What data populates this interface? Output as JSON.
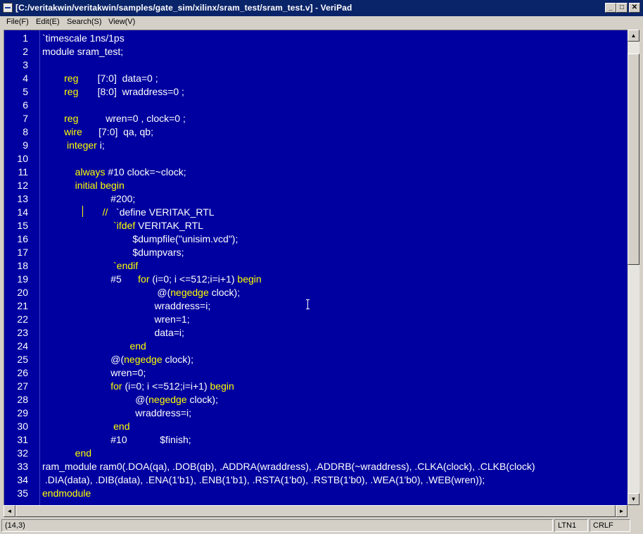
{
  "window": {
    "title": "[C:/veritakwin/veritakwin/samples/gate_sim/xilinx/sram_test/sram_test.v] - VeriPad",
    "minimize_glyph": "_",
    "maximize_glyph": "□",
    "close_glyph": "✕"
  },
  "menu": [
    "File(F)",
    "Edit(E)",
    "Search(S)",
    "View(V)"
  ],
  "editor": {
    "lines": [
      {
        "n": "1",
        "segs": [
          {
            "t": "`timescale 1ns/1ps",
            "c": "plain"
          }
        ]
      },
      {
        "n": "2",
        "segs": [
          {
            "t": "module sram_test;",
            "c": "plain"
          }
        ]
      },
      {
        "n": "3",
        "segs": []
      },
      {
        "n": "4",
        "segs": [
          {
            "t": "        reg       ",
            "c": "kw"
          },
          {
            "t": "[7:0]  data=0 ;",
            "c": "plain"
          }
        ]
      },
      {
        "n": "5",
        "segs": [
          {
            "t": "        reg       ",
            "c": "kw"
          },
          {
            "t": "[8:0]  wraddress=0 ;",
            "c": "plain"
          }
        ]
      },
      {
        "n": "6",
        "segs": []
      },
      {
        "n": "7",
        "segs": [
          {
            "t": "        reg          ",
            "c": "kw"
          },
          {
            "t": "wren=0 , clock=0 ;",
            "c": "plain"
          }
        ]
      },
      {
        "n": "8",
        "segs": [
          {
            "t": "        wire      ",
            "c": "kw"
          },
          {
            "t": "[7:0]  qa, qb;",
            "c": "plain"
          }
        ]
      },
      {
        "n": "9",
        "segs": [
          {
            "t": "         integer ",
            "c": "kw"
          },
          {
            "t": "i;",
            "c": "plain"
          }
        ]
      },
      {
        "n": "10",
        "segs": []
      },
      {
        "n": "11",
        "segs": [
          {
            "t": "            always ",
            "c": "kw"
          },
          {
            "t": "#10 clock=~clock;",
            "c": "plain"
          }
        ]
      },
      {
        "n": "12",
        "segs": [
          {
            "t": "            initial begin",
            "c": "kw"
          }
        ]
      },
      {
        "n": "13",
        "segs": [
          {
            "t": "                         #200;",
            "c": "plain"
          }
        ]
      },
      {
        "n": "14",
        "segs": [
          {
            "t": "                      //   ",
            "c": "kw"
          },
          {
            "t": "`define VERITAK_RTL",
            "c": "plain"
          }
        ]
      },
      {
        "n": "15",
        "segs": [
          {
            "t": "                          `ifdef ",
            "c": "kw"
          },
          {
            "t": "VERITAK_RTL",
            "c": "plain"
          }
        ]
      },
      {
        "n": "16",
        "segs": [
          {
            "t": "                                 $dumpfile(\"unisim.vcd\");",
            "c": "plain"
          }
        ]
      },
      {
        "n": "17",
        "segs": [
          {
            "t": "                                 $dumpvars;",
            "c": "plain"
          }
        ]
      },
      {
        "n": "18",
        "segs": [
          {
            "t": "                          `endif",
            "c": "kw"
          }
        ]
      },
      {
        "n": "19",
        "segs": [
          {
            "t": "                         #5      ",
            "c": "plain"
          },
          {
            "t": "for ",
            "c": "kw"
          },
          {
            "t": "(i=0; i <=512;i=i+1) ",
            "c": "plain"
          },
          {
            "t": "begin",
            "c": "kw"
          }
        ]
      },
      {
        "n": "20",
        "segs": [
          {
            "t": "                                          @(",
            "c": "plain"
          },
          {
            "t": "negedge ",
            "c": "kw"
          },
          {
            "t": "clock);",
            "c": "plain"
          }
        ]
      },
      {
        "n": "21",
        "segs": [
          {
            "t": "                                         wraddress=i;",
            "c": "plain"
          }
        ]
      },
      {
        "n": "22",
        "segs": [
          {
            "t": "                                         wren=1;",
            "c": "plain"
          }
        ]
      },
      {
        "n": "23",
        "segs": [
          {
            "t": "                                         data=i;",
            "c": "plain"
          }
        ]
      },
      {
        "n": "24",
        "segs": [
          {
            "t": "                                end",
            "c": "kw"
          }
        ]
      },
      {
        "n": "25",
        "segs": [
          {
            "t": "                         @(",
            "c": "plain"
          },
          {
            "t": "negedge ",
            "c": "kw"
          },
          {
            "t": "clock);",
            "c": "plain"
          }
        ]
      },
      {
        "n": "26",
        "segs": [
          {
            "t": "                         wren=0;",
            "c": "plain"
          }
        ]
      },
      {
        "n": "27",
        "segs": [
          {
            "t": "                         for ",
            "c": "kw"
          },
          {
            "t": "(i=0; i <=512;i=i+1) ",
            "c": "plain"
          },
          {
            "t": "begin",
            "c": "kw"
          }
        ]
      },
      {
        "n": "28",
        "segs": [
          {
            "t": "                                  @(",
            "c": "plain"
          },
          {
            "t": "negedge ",
            "c": "kw"
          },
          {
            "t": "clock);",
            "c": "plain"
          }
        ]
      },
      {
        "n": "29",
        "segs": [
          {
            "t": "                                  wraddress=i;",
            "c": "plain"
          }
        ]
      },
      {
        "n": "30",
        "segs": [
          {
            "t": "                          end",
            "c": "kw"
          }
        ]
      },
      {
        "n": "31",
        "segs": [
          {
            "t": "                         #10            $finish;",
            "c": "plain"
          }
        ]
      },
      {
        "n": "32",
        "segs": [
          {
            "t": "            end",
            "c": "kw"
          }
        ]
      },
      {
        "n": "33",
        "segs": [
          {
            "t": "ram_module ram0(.DOA(qa), .DOB(qb), .ADDRA(wraddress), .ADDRB(~wraddress), .CLKA(clock), .CLKB(clock)",
            "c": "plain"
          }
        ]
      },
      {
        "n": "34",
        "segs": [
          {
            "t": " .DIA(data), .DIB(data), .ENA(1'b1), .ENB(1'b1), .RSTA(1'b0), .RSTB(1'b0), .WEA(1'b0), .WEB(wren));",
            "c": "plain"
          }
        ]
      },
      {
        "n": "35",
        "segs": [
          {
            "t": "endmodule",
            "c": "kw"
          }
        ]
      }
    ]
  },
  "scroll": {
    "up": "▲",
    "down": "▼",
    "left": "◄",
    "right": "►",
    "vertical_position": 0.05
  },
  "status": {
    "cursor": "(14,3)",
    "line_ending_label": "LTN1",
    "eol": "CRLF"
  },
  "colors": {
    "editor_background": "#0000a0",
    "code_text": "#ffffff",
    "keyword": "#ffff00",
    "title_bar": "#0a246a"
  }
}
